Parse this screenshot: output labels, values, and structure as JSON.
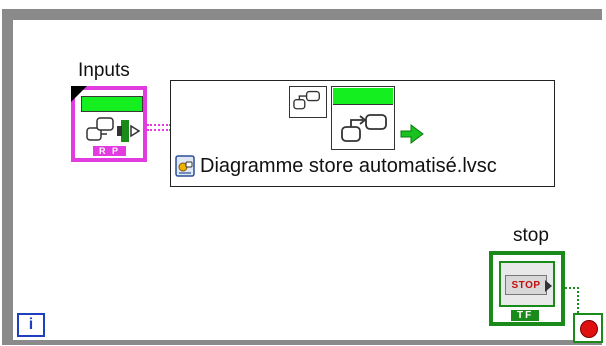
{
  "block_diagram": {
    "inputs_label": "Inputs",
    "inputs_terminal_tag": "R P",
    "chart_file_name": "Diagramme store automatisé.lvsc",
    "stop_label": "stop",
    "stop_button_text": "STOP",
    "stop_terminal_tag": "TF",
    "iteration_text": "i"
  },
  "colors": {
    "loop_frame": "#8a8a8a",
    "cluster_wire": "#e23be0",
    "boolean_wire": "#1a8a1a",
    "state_green": "#14f01f",
    "stop_red": "#e01010",
    "iteration_blue": "#1e3fc0"
  },
  "icons": {
    "inputs_terminal": "statechart-inputs-icon",
    "chart_small": "statechart-icon",
    "chart_big": "statechart-run-icon",
    "output_arrow": "green-arrow-icon",
    "file": "statechart-file-icon",
    "condition": "stop-if-true-icon",
    "iteration": "loop-iteration-icon"
  }
}
